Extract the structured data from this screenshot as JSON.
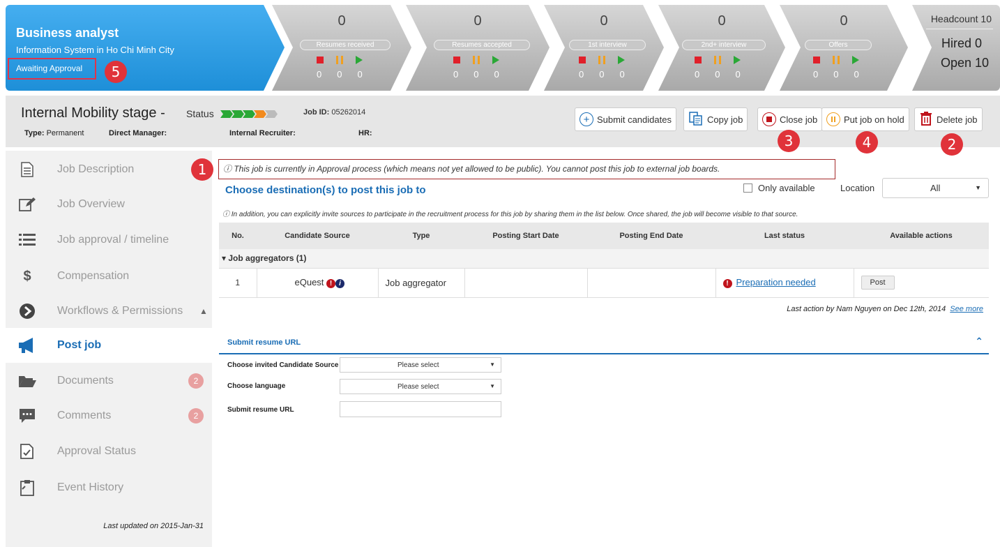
{
  "job": {
    "title": "Business analyst",
    "subtitle": "Information System in Ho Chi Minh City",
    "status": "Awaiting Approval"
  },
  "pipeline": [
    {
      "count": "0",
      "label": "Resumes received",
      "n1": "0",
      "n2": "0",
      "n3": "0"
    },
    {
      "count": "0",
      "label": "Resumes accepted",
      "n1": "0",
      "n2": "0",
      "n3": "0"
    },
    {
      "count": "0",
      "label": "1st interview",
      "n1": "0",
      "n2": "0",
      "n3": "0"
    },
    {
      "count": "0",
      "label": "2nd+ interview",
      "n1": "0",
      "n2": "0",
      "n3": "0"
    },
    {
      "count": "0",
      "label": "Offers",
      "n1": "0",
      "n2": "0",
      "n3": "0"
    }
  ],
  "headcount": {
    "headcount": "Headcount 10",
    "hired": "Hired 0",
    "open": "Open 10"
  },
  "stage": {
    "title": "Internal Mobility stage",
    "dash": "-",
    "status_label": "Status",
    "job_id_label": "Job ID:",
    "job_id": "05262014",
    "type_label": "Type:",
    "type_value": "Permanent",
    "manager_label": "Direct Manager:",
    "recruiter_label": "Internal Recruiter:",
    "hr_label": "HR:"
  },
  "actions": {
    "submit": "Submit candidates",
    "copy": "Copy job",
    "close": "Close job",
    "hold": "Put job on hold",
    "delete": "Delete job"
  },
  "markers": [
    "1",
    "2",
    "3",
    "4",
    "5"
  ],
  "sidebar": {
    "items": [
      {
        "label": "Job Description",
        "icon": "document-icon"
      },
      {
        "label": "Job Overview",
        "icon": "edit-icon"
      },
      {
        "label": "Job approval / timeline",
        "icon": "list-icon"
      },
      {
        "label": "Compensation",
        "icon": "dollar-icon"
      },
      {
        "label": "Workflows & Permissions",
        "icon": "arrow-circle-icon"
      },
      {
        "label": "Post job",
        "icon": "megaphone-icon"
      },
      {
        "label": "Documents",
        "icon": "folder-icon",
        "badge": "2"
      },
      {
        "label": "Comments",
        "icon": "comment-icon",
        "badge": "2"
      },
      {
        "label": "Approval Status",
        "icon": "approval-doc-icon"
      },
      {
        "label": "Event History",
        "icon": "clipboard-icon"
      }
    ],
    "last_updated": "Last updated on 2015-Jan-31"
  },
  "main": {
    "notice": "ⓘ This job is currently in Approval process (which means not yet allowed to be public). You cannot post this job to external job boards.",
    "choose_title": "Choose destination(s) to post this job to",
    "only_available": "Only available",
    "location_label": "Location",
    "location_value": "All",
    "addition": "ⓘ  In addition, you can explicitly invite sources to participate in the recruitment process for this job by sharing them in the list below. Once shared, the job will become visible to that source.",
    "columns": [
      "No.",
      "Candidate Source",
      "Type",
      "Posting Start Date",
      "Posting End Date",
      "Last status",
      "Available actions"
    ],
    "group_label": "▾ Job aggregators (1)",
    "rows": [
      {
        "no": "1",
        "source": "eQuest",
        "type": "Job aggregator",
        "start": "",
        "end": "",
        "status": "Preparation needed",
        "action": "Post"
      }
    ],
    "last_action": "Last action by Nam Nguyen on Dec 12th, 2014",
    "see_more": "See more"
  },
  "submit_form": {
    "title": "Submit resume URL",
    "source_label": "Choose invited Candidate Source",
    "source_value": "Please select",
    "language_label": "Choose language",
    "language_value": "Please select",
    "url_label": "Submit resume URL"
  },
  "colors": {
    "accent": "#1a6db5",
    "banner_blue": "#2a9de6",
    "marker_red": "#e0333a"
  }
}
